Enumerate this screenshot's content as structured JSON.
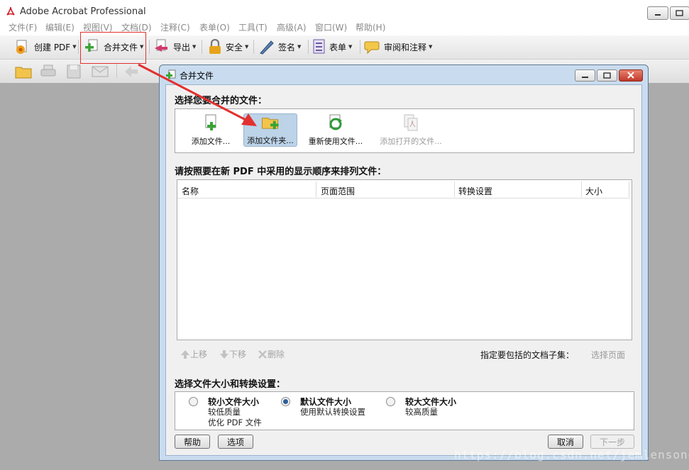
{
  "app": {
    "title": "Adobe Acrobat Professional"
  },
  "menu": [
    "文件(F)",
    "编辑(E)",
    "视图(V)",
    "文档(D)",
    "注释(C)",
    "表单(O)",
    "工具(T)",
    "高级(A)",
    "窗口(W)",
    "帮助(H)"
  ],
  "toolbar": {
    "create_pdf": "创建 PDF",
    "combine": "合并文件",
    "export": "导出",
    "security": "安全",
    "sign": "签名",
    "forms": "表单",
    "review": "审阅和注释"
  },
  "dialog": {
    "title": "合并文件",
    "select_label": "选择您要合并的文件：",
    "tools": {
      "add_files": "添加文件...",
      "add_folder": "添加文件夹...",
      "reuse": "重新使用文件...",
      "add_open": "添加打开的文件..."
    },
    "order_label": "请按照要在新 PDF 中采用的显示顺序来排列文件：",
    "columns": [
      "名称",
      "页面范围",
      "转换设置",
      "大小"
    ],
    "move_up": "上移",
    "move_down": "下移",
    "delete": "删除",
    "subset_label": "指定要包括的文档子集：",
    "choose_pages": "选择页面",
    "size_label": "选择文件大小和转换设置：",
    "options": [
      {
        "title": "较小文件大小",
        "line1": "较低质量",
        "line2": "优化 PDF 文件",
        "selected": false
      },
      {
        "title": "默认文件大小",
        "line1": "使用默认转换设置",
        "line2": "",
        "selected": true
      },
      {
        "title": "较大文件大小",
        "line1": "较高质量",
        "line2": "",
        "selected": false
      }
    ],
    "help": "帮助",
    "options_btn": "选项",
    "cancel": "取消",
    "next": "下一步"
  },
  "watermark": "https://blog.csdn.net/jemlensong"
}
